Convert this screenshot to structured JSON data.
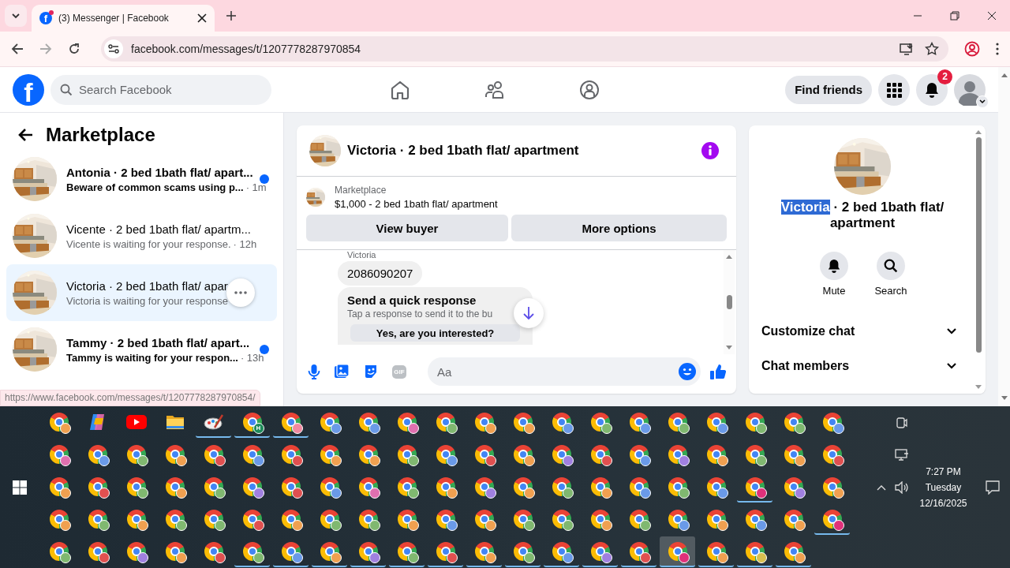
{
  "browser": {
    "tab": {
      "title": "(3) Messenger | Facebook",
      "icon_letter": "f",
      "notification": true
    },
    "url": "facebook.com/messages/t/1207778287970854",
    "status_url": "https://www.facebook.com/messages/t/1207778287970854/"
  },
  "header": {
    "logo": "f",
    "search_placeholder": "Search Facebook",
    "nav": [
      {
        "kind": "home"
      },
      {
        "kind": "friends"
      },
      {
        "kind": "groups"
      }
    ],
    "find_friends": "Find friends",
    "notification_count": "2"
  },
  "sidebar": {
    "title": "Marketplace",
    "conversations": [
      {
        "name": "Antonia · 2 bed 1bath flat/ apart...",
        "preview": "Beware of common scams using p...",
        "time": "· 1m",
        "unread": true,
        "selected": false,
        "more_button": false
      },
      {
        "name": "Vicente · 2 bed 1bath flat/ apartm...",
        "preview": "Vicente is waiting for your response.",
        "time": "· 12h",
        "unread": false,
        "selected": false,
        "more_button": false
      },
      {
        "name": "Victoria · 2 bed 1bath flat/ apar",
        "preview": "Victoria is waiting for your response",
        "unread": false,
        "selected": true,
        "more_button": true
      },
      {
        "name": "Tammy · 2 bed 1bath flat/ apart...",
        "preview": "Tammy is waiting for your respon...",
        "time": "· 13h",
        "unread": true,
        "selected": false,
        "more_button": false
      }
    ]
  },
  "chat": {
    "title": "Victoria · 2 bed 1bath flat/ apartment",
    "listing_label": "Marketplace",
    "listing": "$1,000 - 2 bed 1bath flat/ apartment",
    "buttons": [
      "View buyer",
      "More options"
    ],
    "sender": "Victoria",
    "messages": [
      {
        "kind": "text",
        "text": "2086090207"
      },
      {
        "kind": "quick_response",
        "title": "Send a quick response",
        "subtitle": "Tap a response to send it to the bu",
        "option": "Yes, are you interested?"
      }
    ],
    "composer": {
      "placeholder": "Aa",
      "gif_label": "GIF"
    }
  },
  "details": {
    "title_parts": [
      {
        "text": "Victoria",
        "highlighted": true
      },
      {
        "text": " · 2 bed 1bath flat/ apartment",
        "highlighted": false
      }
    ],
    "actions": [
      {
        "kind": "bell",
        "label": "Mute"
      },
      {
        "kind": "search",
        "label": "Search"
      }
    ],
    "sections": [
      {
        "label": "Customize chat",
        "expanded": false
      },
      {
        "label": "Chat members",
        "expanded": false
      }
    ]
  },
  "taskbar": {
    "clock": {
      "time": "7:27 PM",
      "day": "Tuesday",
      "date": "12/16/2025"
    },
    "rows": [
      [
        {
          "kind": "chrome",
          "color": "#f0a050",
          "open": false,
          "selected": false
        },
        {
          "kind": "copilot",
          "open": false,
          "selected": false
        },
        {
          "kind": "youtube",
          "open": false,
          "selected": false
        },
        {
          "kind": "folder",
          "open": false,
          "selected": false
        },
        {
          "kind": "paint",
          "open": true,
          "selected": false
        },
        {
          "kind": "chrome",
          "color": "#1e8a5a",
          "badge_text": "H",
          "open": true,
          "selected": false
        },
        {
          "kind": "chrome",
          "color": "#f08aa0",
          "open": true,
          "selected": false
        },
        {
          "kind": "chrome",
          "color": "#6a9ae8",
          "open": false,
          "selected": false
        },
        {
          "kind": "chrome",
          "color": "#6a9ae8",
          "open": false,
          "selected": false
        },
        {
          "kind": "chrome",
          "color": "#e070b0",
          "open": false,
          "selected": false
        },
        {
          "kind": "chrome",
          "color": "#80b870",
          "open": false,
          "selected": false
        },
        {
          "kind": "chrome",
          "color": "#f0a050",
          "open": false,
          "selected": false
        },
        {
          "kind": "chrome",
          "color": "#f0a050",
          "open": false,
          "selected": false
        },
        {
          "kind": "chrome",
          "color": "#6a9ae8",
          "open": false,
          "selected": false
        },
        {
          "kind": "chrome",
          "color": "#80b870",
          "open": false,
          "selected": false
        },
        {
          "kind": "chrome",
          "color": "#6a9ae8",
          "open": false,
          "selected": false
        },
        {
          "kind": "chrome",
          "color": "#80b870",
          "open": false,
          "selected": false
        },
        {
          "kind": "chrome",
          "color": "#6a9ae8",
          "open": false,
          "selected": false
        },
        {
          "kind": "chrome",
          "color": "#80b870",
          "open": false,
          "selected": false
        },
        {
          "kind": "chrome",
          "color": "#80b870",
          "open": false,
          "selected": false
        },
        {
          "kind": "chrome",
          "color": "#6a9ae8",
          "open": false,
          "selected": false
        }
      ],
      [
        {
          "kind": "chrome",
          "color": "#e070b0",
          "open": false,
          "selected": false
        },
        {
          "kind": "chrome",
          "color": "#6a9ae8",
          "open": false,
          "selected": false
        },
        {
          "kind": "chrome",
          "color": "#80b870",
          "open": false,
          "selected": false
        },
        {
          "kind": "chrome",
          "color": "#f0a050",
          "open": false,
          "selected": false
        },
        {
          "kind": "chrome",
          "color": "#e05050",
          "open": false,
          "selected": false
        },
        {
          "kind": "chrome",
          "color": "#6a9ae8",
          "open": false,
          "selected": false
        },
        {
          "kind": "chrome",
          "color": "#e05050",
          "open": false,
          "selected": false
        },
        {
          "kind": "chrome",
          "color": "#f0a050",
          "open": false,
          "selected": false
        },
        {
          "kind": "chrome",
          "color": "#f0a050",
          "open": false,
          "selected": false
        },
        {
          "kind": "chrome",
          "color": "#80b870",
          "open": false,
          "selected": false
        },
        {
          "kind": "chrome",
          "color": "#6a9ae8",
          "open": false,
          "selected": false
        },
        {
          "kind": "chrome",
          "color": "#e05050",
          "open": false,
          "selected": false
        },
        {
          "kind": "chrome",
          "color": "#f0a050",
          "open": false,
          "selected": false
        },
        {
          "kind": "chrome",
          "color": "#a080e0",
          "open": false,
          "selected": false
        },
        {
          "kind": "chrome",
          "color": "#e05050",
          "open": false,
          "selected": false
        },
        {
          "kind": "chrome",
          "color": "#6a9ae8",
          "open": false,
          "selected": false
        },
        {
          "kind": "chrome",
          "color": "#a080e0",
          "open": false,
          "selected": false
        },
        {
          "kind": "chrome",
          "color": "#f0a050",
          "open": false,
          "selected": false
        },
        {
          "kind": "chrome",
          "color": "#80b870",
          "open": false,
          "selected": false
        },
        {
          "kind": "chrome",
          "color": "#f0a050",
          "open": false,
          "selected": false
        },
        {
          "kind": "chrome",
          "color": "#e05050",
          "open": false,
          "selected": false
        }
      ],
      [
        {
          "kind": "chrome",
          "color": "#f0a050",
          "open": false,
          "selected": false
        },
        {
          "kind": "chrome",
          "color": "#e05050",
          "open": false,
          "selected": false
        },
        {
          "kind": "chrome",
          "color": "#80b870",
          "open": false,
          "selected": false
        },
        {
          "kind": "chrome",
          "color": "#f0a050",
          "open": false,
          "selected": false
        },
        {
          "kind": "chrome",
          "color": "#80b870",
          "open": false,
          "selected": false
        },
        {
          "kind": "chrome",
          "color": "#a080e0",
          "open": false,
          "selected": false
        },
        {
          "kind": "chrome",
          "color": "#e05050",
          "open": false,
          "selected": false
        },
        {
          "kind": "chrome",
          "color": "#6a9ae8",
          "open": false,
          "selected": false
        },
        {
          "kind": "chrome",
          "color": "#e070b0",
          "open": false,
          "selected": false
        },
        {
          "kind": "chrome",
          "color": "#80b870",
          "open": false,
          "selected": false
        },
        {
          "kind": "chrome",
          "color": "#f0a050",
          "open": false,
          "selected": false
        },
        {
          "kind": "chrome",
          "color": "#a080e0",
          "open": false,
          "selected": false
        },
        {
          "kind": "chrome",
          "color": "#f0a050",
          "open": false,
          "selected": false
        },
        {
          "kind": "chrome",
          "color": "#80b870",
          "open": false,
          "selected": false
        },
        {
          "kind": "chrome",
          "color": "#f0a050",
          "open": false,
          "selected": false
        },
        {
          "kind": "chrome",
          "color": "#6a9ae8",
          "open": false,
          "selected": false
        },
        {
          "kind": "chrome",
          "color": "#80b870",
          "open": false,
          "selected": false
        },
        {
          "kind": "chrome",
          "color": "#6a9ae8",
          "open": false,
          "selected": false
        },
        {
          "kind": "chrome",
          "color": "#e0307a",
          "open": true,
          "selected": false
        },
        {
          "kind": "chrome",
          "color": "#a080e0",
          "open": false,
          "selected": false
        },
        {
          "kind": "chrome",
          "color": "#f0a050",
          "open": false,
          "selected": false
        }
      ],
      [
        {
          "kind": "chrome",
          "color": "#f0a050",
          "open": false,
          "selected": false
        },
        {
          "kind": "chrome",
          "color": "#80b870",
          "open": false,
          "selected": false
        },
        {
          "kind": "chrome",
          "color": "#f0a050",
          "open": false,
          "selected": false
        },
        {
          "kind": "chrome",
          "color": "#80b870",
          "open": false,
          "selected": false
        },
        {
          "kind": "chrome",
          "color": "#80b870",
          "open": false,
          "selected": false
        },
        {
          "kind": "chrome",
          "color": "#e05050",
          "open": false,
          "selected": false
        },
        {
          "kind": "chrome",
          "color": "#f0a050",
          "open": false,
          "selected": false
        },
        {
          "kind": "chrome",
          "color": "#80b870",
          "open": false,
          "selected": false
        },
        {
          "kind": "chrome",
          "color": "#80b870",
          "open": false,
          "selected": false
        },
        {
          "kind": "chrome",
          "color": "#f0a050",
          "open": false,
          "selected": false
        },
        {
          "kind": "chrome",
          "color": "#6a9ae8",
          "open": false,
          "selected": false
        },
        {
          "kind": "chrome",
          "color": "#f0a050",
          "open": false,
          "selected": false
        },
        {
          "kind": "chrome",
          "color": "#80b870",
          "open": false,
          "selected": false
        },
        {
          "kind": "chrome",
          "color": "#80b870",
          "open": false,
          "selected": false
        },
        {
          "kind": "chrome",
          "color": "#f0a050",
          "open": false,
          "selected": false
        },
        {
          "kind": "chrome",
          "color": "#80b870",
          "open": false,
          "selected": false
        },
        {
          "kind": "chrome",
          "color": "#6a9ae8",
          "open": false,
          "selected": false
        },
        {
          "kind": "chrome",
          "color": "#f0a050",
          "open": false,
          "selected": false
        },
        {
          "kind": "chrome",
          "color": "#6a9ae8",
          "open": false,
          "selected": false
        },
        {
          "kind": "chrome",
          "color": "#f0a050",
          "open": false,
          "selected": false
        },
        {
          "kind": "chrome",
          "color": "#e0307a",
          "open": true,
          "selected": false
        }
      ],
      [
        {
          "kind": "chrome",
          "color": "#80b870",
          "open": false,
          "selected": false
        },
        {
          "kind": "chrome",
          "color": "#e05050",
          "open": false,
          "selected": false
        },
        {
          "kind": "chrome",
          "color": "#a080e0",
          "open": false,
          "selected": false
        },
        {
          "kind": "chrome",
          "color": "#f0a050",
          "open": false,
          "selected": false
        },
        {
          "kind": "chrome",
          "color": "#e05050",
          "open": false,
          "selected": false
        },
        {
          "kind": "chrome",
          "color": "#80b870",
          "open": true,
          "selected": false
        },
        {
          "kind": "chrome",
          "color": "#6a9ae8",
          "open": true,
          "selected": false
        },
        {
          "kind": "chrome",
          "color": "#f0a050",
          "open": true,
          "selected": false
        },
        {
          "kind": "chrome",
          "color": "#a080e0",
          "open": true,
          "selected": false
        },
        {
          "kind": "chrome",
          "color": "#80b870",
          "open": true,
          "selected": false
        },
        {
          "kind": "chrome",
          "color": "#e05050",
          "open": true,
          "selected": false
        },
        {
          "kind": "chrome",
          "color": "#f0a050",
          "open": true,
          "selected": false
        },
        {
          "kind": "chrome",
          "color": "#80b870",
          "open": true,
          "selected": false
        },
        {
          "kind": "chrome",
          "color": "#6a9ae8",
          "open": true,
          "selected": false
        },
        {
          "kind": "chrome",
          "color": "#a080e0",
          "open": true,
          "selected": false
        },
        {
          "kind": "chrome",
          "color": "#e05050",
          "open": true,
          "selected": false
        },
        {
          "kind": "chrome",
          "color": "#e0307a",
          "open": true,
          "selected": true
        },
        {
          "kind": "chrome",
          "color": "#f0a050",
          "open": true,
          "selected": false
        },
        {
          "kind": "chrome",
          "color": "#d8c050",
          "open": true,
          "selected": false
        },
        {
          "kind": "chrome",
          "color": "#f0a050",
          "open": true,
          "selected": false
        }
      ]
    ]
  }
}
